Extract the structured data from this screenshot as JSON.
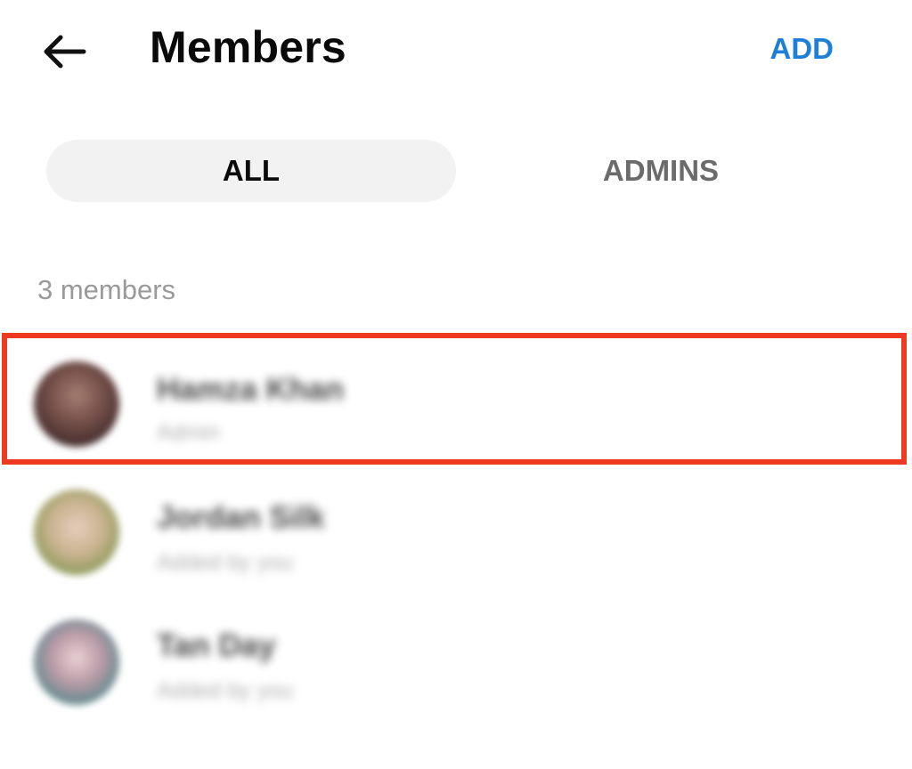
{
  "header": {
    "title": "Members",
    "add_label": "ADD",
    "back_icon": "arrow-left-icon",
    "accent_color": "#1e7fd8"
  },
  "tabs": [
    {
      "label": "ALL",
      "selected": true
    },
    {
      "label": "ADMINS",
      "selected": false
    }
  ],
  "section": {
    "count_label": "3 members"
  },
  "members": [
    {
      "name": "Hamza Khan",
      "subtitle": "Admin",
      "highlighted": true
    },
    {
      "name": "Jordan Silk",
      "subtitle": "Added by you",
      "highlighted": false
    },
    {
      "name": "Tan Day",
      "subtitle": "Added by you",
      "highlighted": false
    }
  ],
  "highlight_color": "#ee3b1f"
}
